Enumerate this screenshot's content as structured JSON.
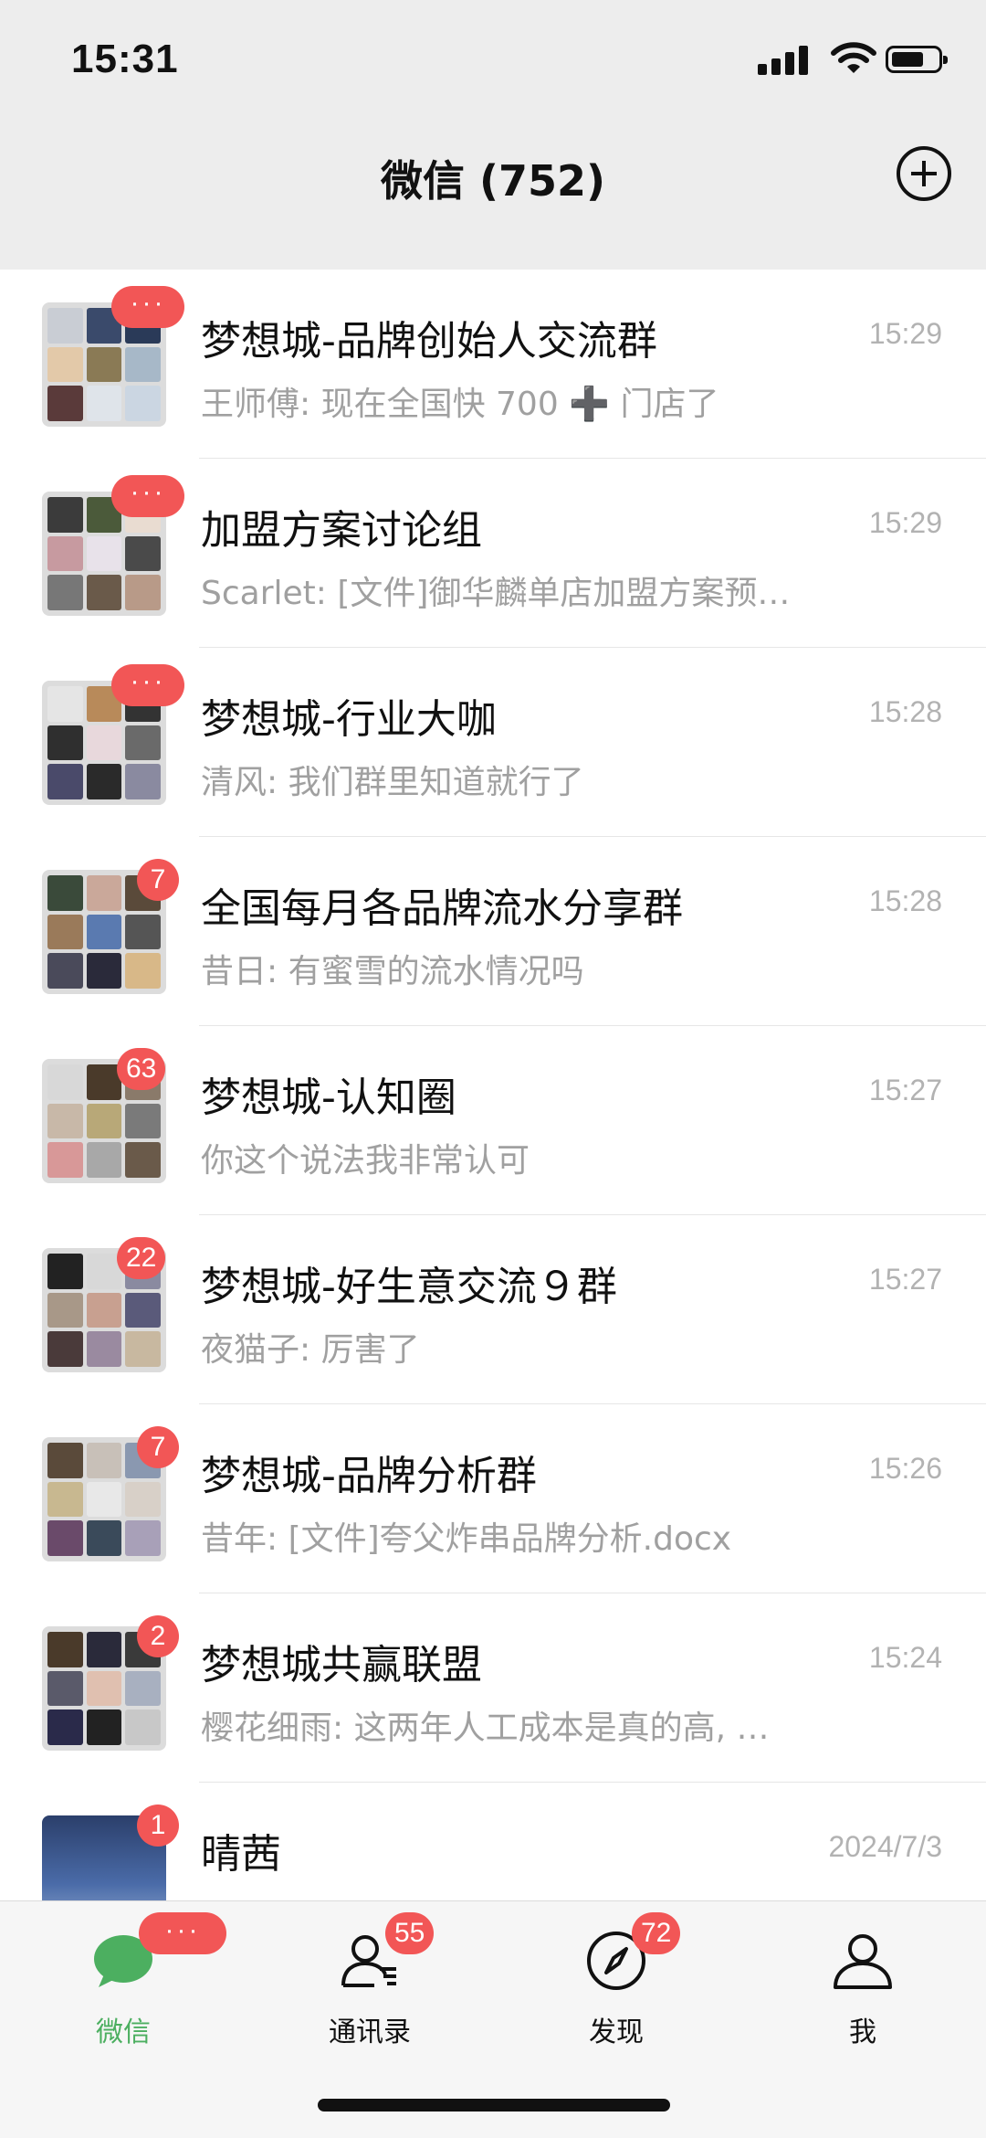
{
  "status": {
    "time": "15:31"
  },
  "header": {
    "title": "微信 (752)"
  },
  "chats": [
    {
      "name": "梦想城-品牌创始人交流群",
      "time": "15:29",
      "preview": "王师傅: 现在全国快 700 ➕ 门店了",
      "badge": "···"
    },
    {
      "name": "加盟方案讨论组",
      "time": "15:29",
      "preview": "Scarlet: [文件]御华麟单店加盟方案预…",
      "badge": "···"
    },
    {
      "name": "梦想城-行业大咖",
      "time": "15:28",
      "preview": "清风: 我们群里知道就行了",
      "badge": "···"
    },
    {
      "name": "全国每月各品牌流水分享群",
      "time": "15:28",
      "preview": "昔日: 有蜜雪的流水情况吗",
      "badge": "7"
    },
    {
      "name": "梦想城-认知圈",
      "time": "15:27",
      "preview": "你这个说法我非常认可",
      "badge": "63"
    },
    {
      "name": "梦想城-好生意交流９群",
      "time": "15:27",
      "preview": "夜猫子: 厉害了",
      "badge": "22"
    },
    {
      "name": "梦想城-品牌分析群",
      "time": "15:26",
      "preview": "昔年: [文件]夸父炸串品牌分析.docx",
      "badge": "7"
    },
    {
      "name": "梦想城共赢联盟",
      "time": "15:24",
      "preview": "樱花细雨: 这两年人工成本是真的高, …",
      "badge": "2"
    },
    {
      "name": "晴茜",
      "time": "2024/7/3",
      "preview": "",
      "badge": "1"
    }
  ],
  "tabs": [
    {
      "label": "微信",
      "badge": "···",
      "icon": "chat-bubble-icon",
      "active": true
    },
    {
      "label": "通讯录",
      "badge": "55",
      "icon": "contacts-icon",
      "active": false
    },
    {
      "label": "发现",
      "badge": "72",
      "icon": "compass-icon",
      "active": false
    },
    {
      "label": "我",
      "badge": "",
      "icon": "person-icon",
      "active": false
    }
  ],
  "colors": {
    "badge": "#f25656",
    "active_tab": "#4caf60",
    "header_bg": "#ededed"
  }
}
